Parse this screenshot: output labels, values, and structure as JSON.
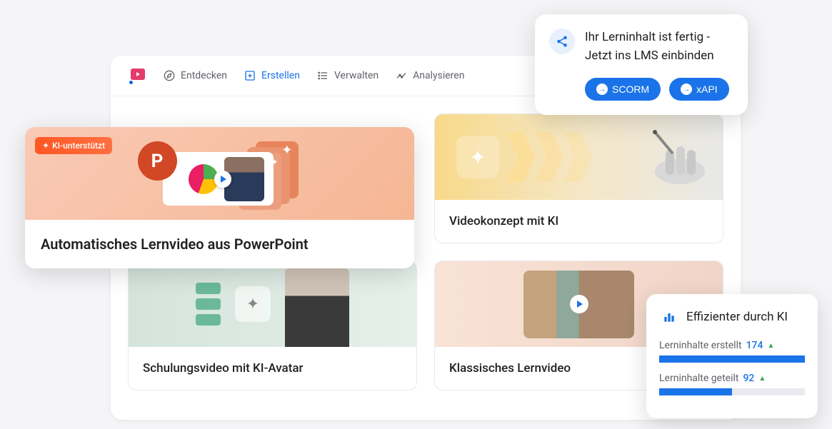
{
  "nav": {
    "items": [
      {
        "label": "Entdecken",
        "icon": "compass-icon"
      },
      {
        "label": "Erstellen",
        "icon": "plus-box-icon",
        "active": true
      },
      {
        "label": "Verwalten",
        "icon": "list-icon"
      },
      {
        "label": "Analysieren",
        "icon": "trend-icon"
      }
    ]
  },
  "featured": {
    "badge": "KI-unterstützt",
    "title": "Automatisches Lernvideo aus PowerPoint",
    "ppt_letter": "P"
  },
  "cards": [
    {
      "title": "Videokonzept mit KI"
    },
    {
      "title": "Schulungsvideo mit KI-Avatar"
    },
    {
      "title": "Klassisches Lernvideo"
    }
  ],
  "lms": {
    "message_line1": "Ihr Lerninhalt ist fertig -",
    "message_line2": "Jetzt ins LMS einbinden",
    "btn1": "SCORM",
    "btn2": "xAPI"
  },
  "stats": {
    "title": "Effizienter durch KI",
    "rows": [
      {
        "label": "Lerninhalte erstellt",
        "value": "174",
        "bar_pct": 100
      },
      {
        "label": "Lerninhalte geteilt",
        "value": "92",
        "bar_pct": 50
      }
    ]
  }
}
